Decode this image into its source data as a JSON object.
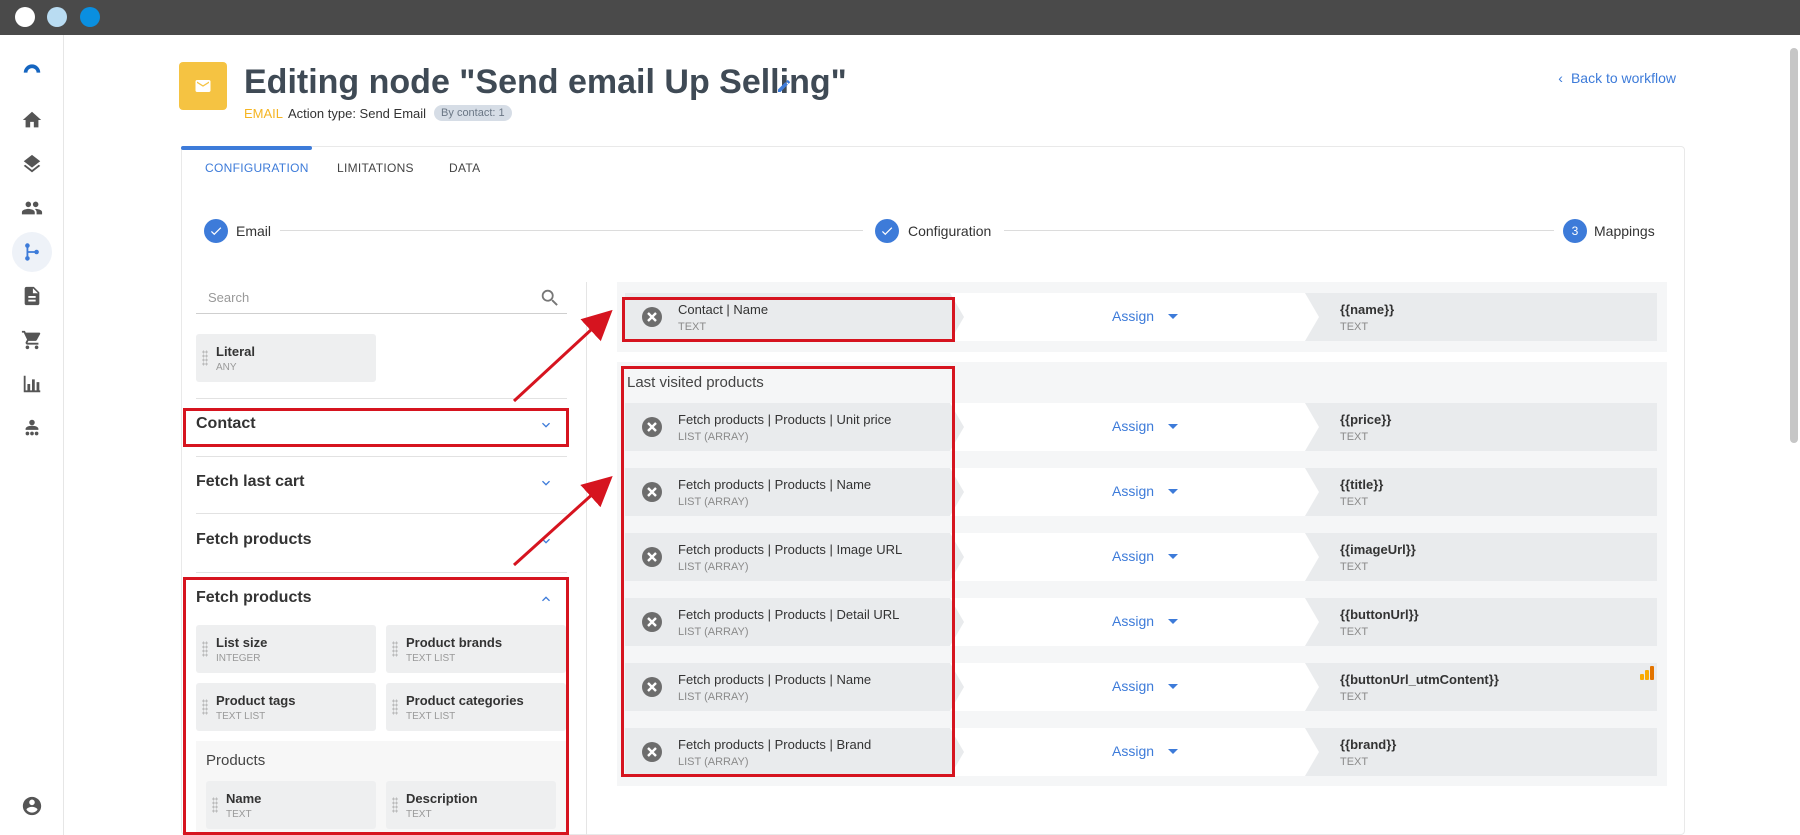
{
  "header": {
    "title": "Editing node \"Send email Up Selling\"",
    "node_type": "EMAIL",
    "action_type": "Action type: Send Email",
    "badge": "By contact: 1",
    "back_link": "Back to workflow"
  },
  "sidebar": {
    "items": [
      {
        "icon": "logo-icon"
      },
      {
        "icon": "home-icon"
      },
      {
        "icon": "layers-icon"
      },
      {
        "icon": "people-icon"
      },
      {
        "icon": "workflow-icon",
        "active": true
      },
      {
        "icon": "document-icon"
      },
      {
        "icon": "cart-icon"
      },
      {
        "icon": "chart-icon"
      },
      {
        "icon": "support-icon"
      },
      {
        "icon": "account-icon"
      }
    ]
  },
  "tabs": [
    {
      "label": "CONFIGURATION",
      "active": true
    },
    {
      "label": "LIMITATIONS"
    },
    {
      "label": "DATA"
    }
  ],
  "stepper": {
    "steps": [
      {
        "label": "Email",
        "state": "done"
      },
      {
        "label": "Configuration",
        "state": "done"
      },
      {
        "label": "Mappings",
        "state": "current",
        "number": "3"
      }
    ]
  },
  "left_panel": {
    "search_placeholder": "Search",
    "literal": {
      "name": "Literal",
      "type": "ANY"
    },
    "sections": [
      {
        "title": "Contact",
        "expanded": false
      },
      {
        "title": "Fetch last cart",
        "expanded": false
      },
      {
        "title": "Fetch products",
        "expanded": false
      },
      {
        "title": "Fetch products",
        "expanded": true
      }
    ],
    "fetch_products_fields": [
      {
        "name": "List size",
        "type": "INTEGER"
      },
      {
        "name": "Product brands",
        "type": "TEXT LIST"
      },
      {
        "name": "Product tags",
        "type": "TEXT LIST"
      },
      {
        "name": "Product categories",
        "type": "TEXT LIST"
      }
    ],
    "products_label": "Products",
    "products_fields": [
      {
        "name": "Name",
        "type": "TEXT"
      },
      {
        "name": "Description",
        "type": "TEXT"
      }
    ]
  },
  "mappings": {
    "assign_label": "Assign",
    "single": {
      "source": "Contact | Name",
      "source_type": "TEXT",
      "target": "{{name}}",
      "target_type": "TEXT"
    },
    "group_label": "Last visited products",
    "rows": [
      {
        "source": "Fetch products | Products | Unit price",
        "source_type": "LIST (ARRAY)",
        "target": "{{price}}",
        "target_type": "TEXT"
      },
      {
        "source": "Fetch products | Products | Name",
        "source_type": "LIST (ARRAY)",
        "target": "{{title}}",
        "target_type": "TEXT"
      },
      {
        "source": "Fetch products | Products | Image URL",
        "source_type": "LIST (ARRAY)",
        "target": "{{imageUrl}}",
        "target_type": "TEXT"
      },
      {
        "source": "Fetch products | Products | Detail URL",
        "source_type": "LIST (ARRAY)",
        "target": "{{buttonUrl}}",
        "target_type": "TEXT"
      },
      {
        "source": "Fetch products | Products | Name",
        "source_type": "LIST (ARRAY)",
        "target": "{{buttonUrl_utmContent}}",
        "target_type": "TEXT"
      },
      {
        "source": "Fetch products | Products | Brand",
        "source_type": "LIST (ARRAY)",
        "target": "{{brand}}",
        "target_type": "TEXT"
      }
    ]
  },
  "colors": {
    "accent": "#3d7bd9",
    "email_yellow": "#f5c342",
    "annotation_red": "#d6141f"
  }
}
